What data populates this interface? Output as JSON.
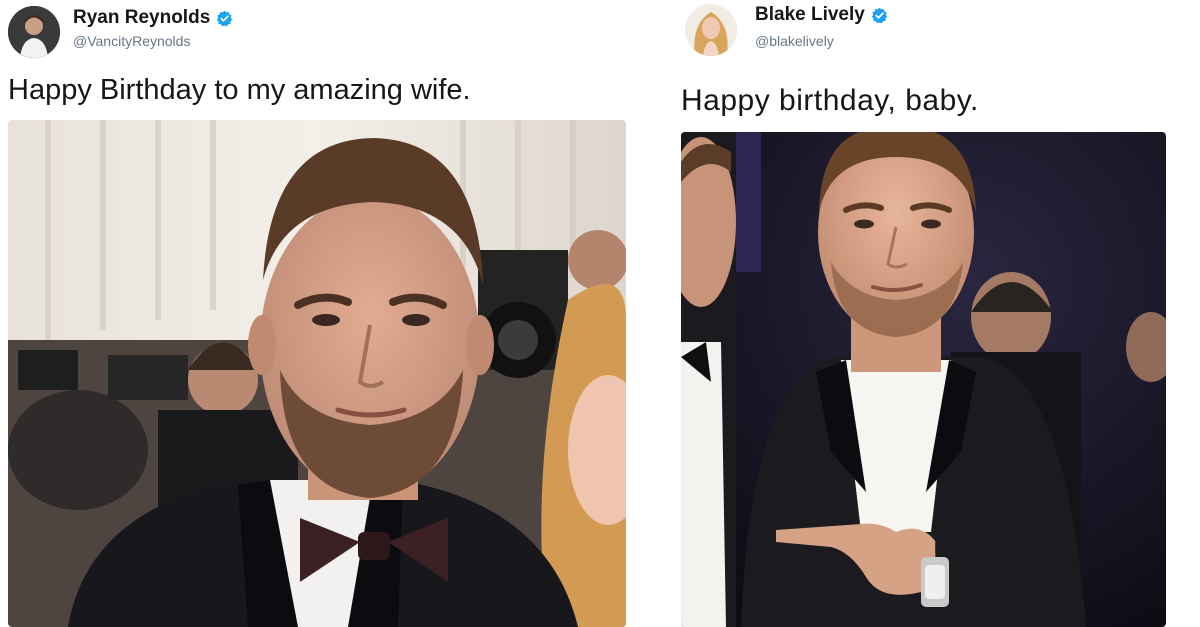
{
  "tweets": [
    {
      "display_name": "Ryan Reynolds",
      "handle": "@VancityReynolds",
      "verified": true,
      "text": "Happy Birthday to my amazing wife."
    },
    {
      "display_name": "Blake Lively",
      "handle": "@blakelively",
      "verified": true,
      "text": "Happy birthday, baby."
    }
  ],
  "colors": {
    "verified_badge": "#1da1f2",
    "name_text": "#14171a",
    "handle_text": "#657786"
  },
  "icons": {
    "verified": "verified-badge-icon"
  }
}
